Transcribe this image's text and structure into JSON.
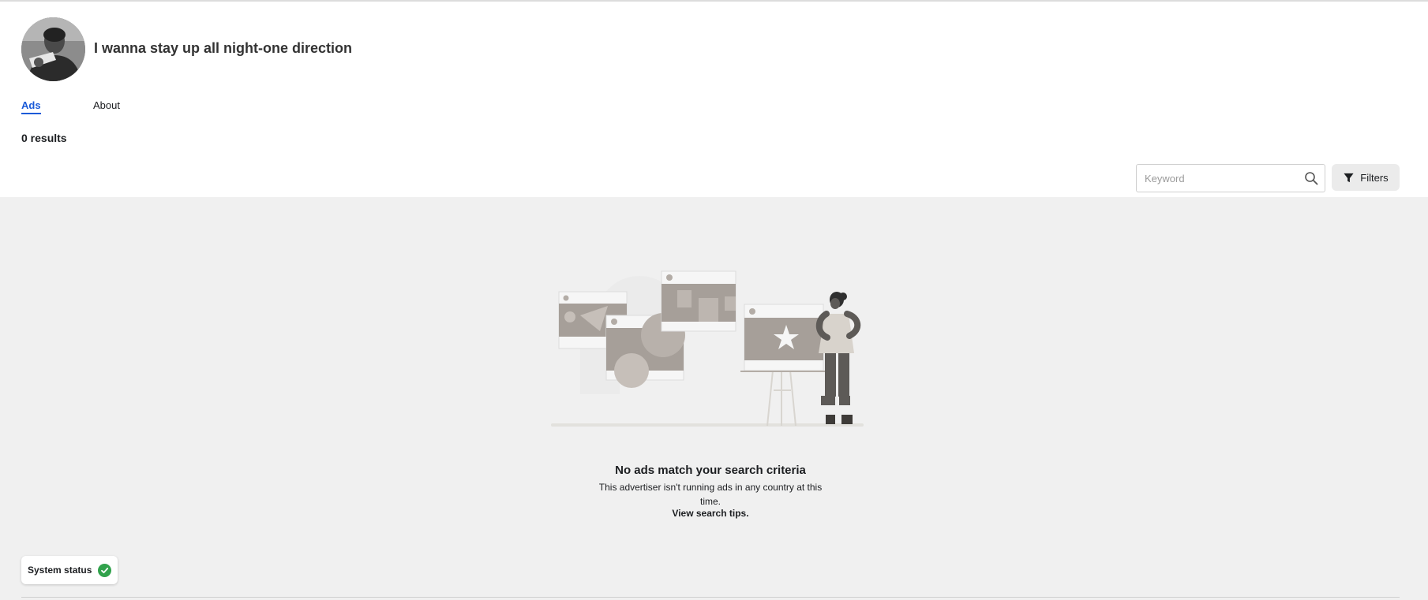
{
  "advertiser": {
    "name": "I wanna stay up all night-one direction",
    "avatar_icon": "profile-photo"
  },
  "tabs": [
    {
      "label": "Ads",
      "active": true
    },
    {
      "label": "About",
      "active": false
    }
  ],
  "results": {
    "count_label": "0 results"
  },
  "search": {
    "placeholder": "Keyword",
    "value": "",
    "icon": "search-icon"
  },
  "filters": {
    "label": "Filters",
    "icon": "filter-icon"
  },
  "empty_state": {
    "title": "No ads match your search criteria",
    "description": "This advertiser isn't running ads in any country at this time.",
    "link_label": "View search tips."
  },
  "system_status": {
    "label": "System status",
    "icon": "check-circle-icon",
    "status_color": "#31a24c"
  },
  "colors": {
    "accent": "#1a5ad8",
    "page_background": "#f0f0f0",
    "header_background": "#ffffff"
  }
}
